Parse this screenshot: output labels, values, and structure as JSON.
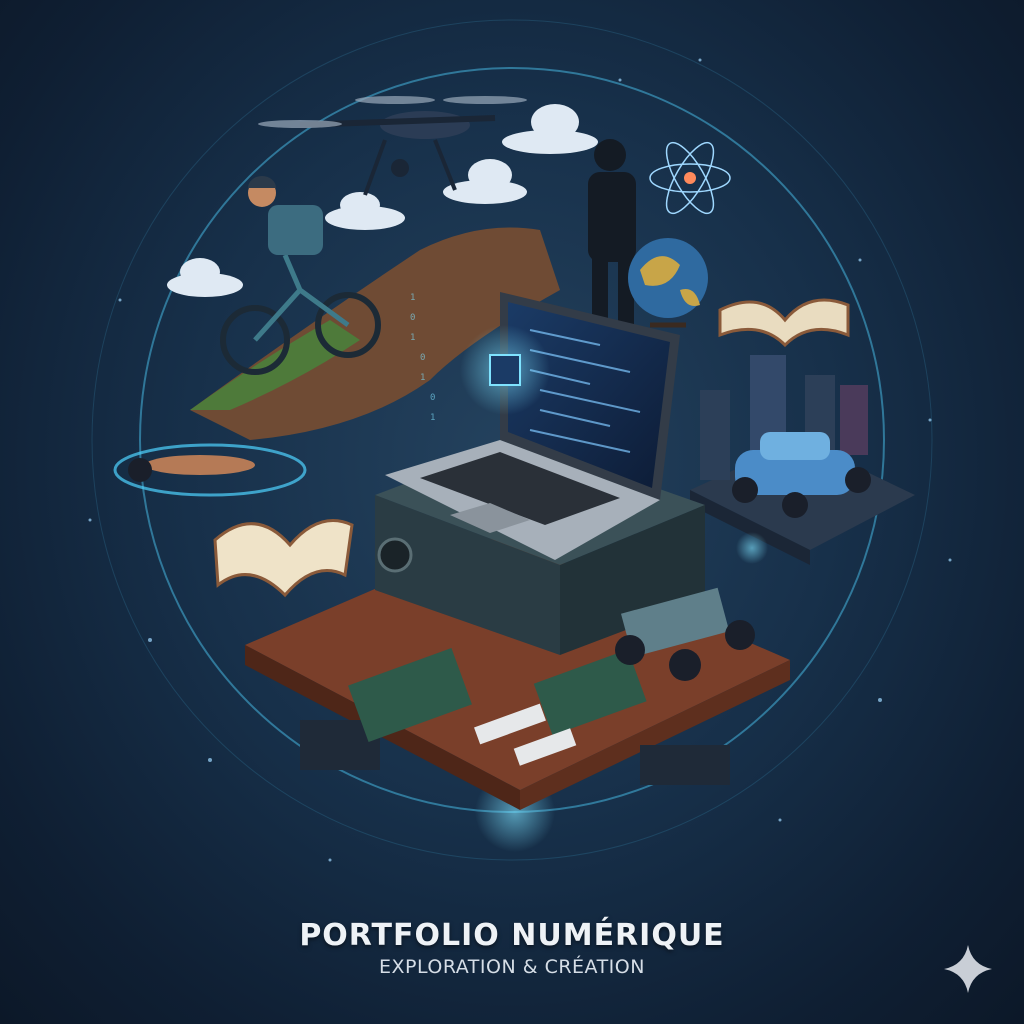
{
  "title": "PORTFOLIO NUMÉRIQUE",
  "subtitle": "EXPLORATION & CRÉATION",
  "colors": {
    "background": "#17304a",
    "ring": "#4fd3ff",
    "accent_pink": "#ff5fd0",
    "desk": "#7a3f2a"
  }
}
